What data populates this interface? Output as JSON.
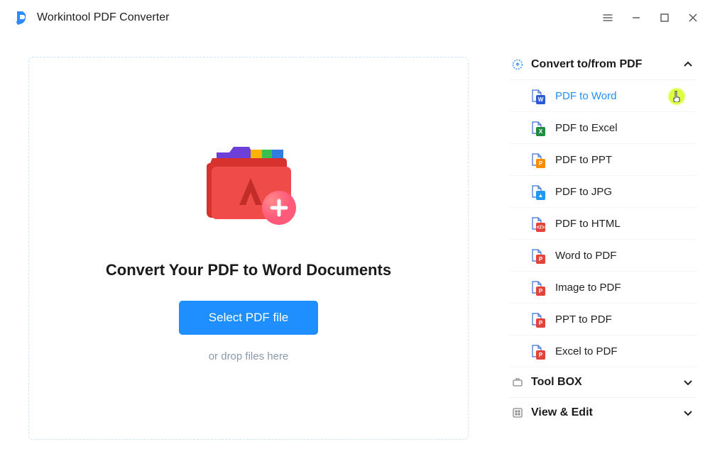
{
  "app": {
    "title": "Workintool PDF Converter"
  },
  "main": {
    "heading": "Convert Your PDF to Word Documents",
    "select_button": "Select PDF file",
    "drop_hint": "or drop files here"
  },
  "sidebar": {
    "sections": [
      {
        "id": "convert",
        "title": "Convert to/from PDF",
        "expanded": true,
        "items": [
          {
            "label": "PDF to Word",
            "badge": "W",
            "badge_color": "blue",
            "active": true,
            "cursor": true
          },
          {
            "label": "PDF to Excel",
            "badge": "X",
            "badge_color": "green",
            "active": false
          },
          {
            "label": "PDF to PPT",
            "badge": "P",
            "badge_color": "orange",
            "active": false
          },
          {
            "label": "PDF to JPG",
            "badge": "▲",
            "badge_color": "sky",
            "active": false
          },
          {
            "label": "PDF to HTML",
            "badge": "</>",
            "badge_color": "redcode",
            "active": false
          },
          {
            "label": "Word to PDF",
            "badge": "P",
            "badge_color": "red",
            "active": false
          },
          {
            "label": "Image to PDF",
            "badge": "P",
            "badge_color": "red",
            "active": false
          },
          {
            "label": "PPT to PDF",
            "badge": "P",
            "badge_color": "red",
            "active": false
          },
          {
            "label": "Excel to PDF",
            "badge": "P",
            "badge_color": "red",
            "active": false
          }
        ]
      },
      {
        "id": "toolbox",
        "title": "Tool BOX",
        "expanded": false
      },
      {
        "id": "viewedit",
        "title": "View & Edit",
        "expanded": false
      }
    ]
  }
}
